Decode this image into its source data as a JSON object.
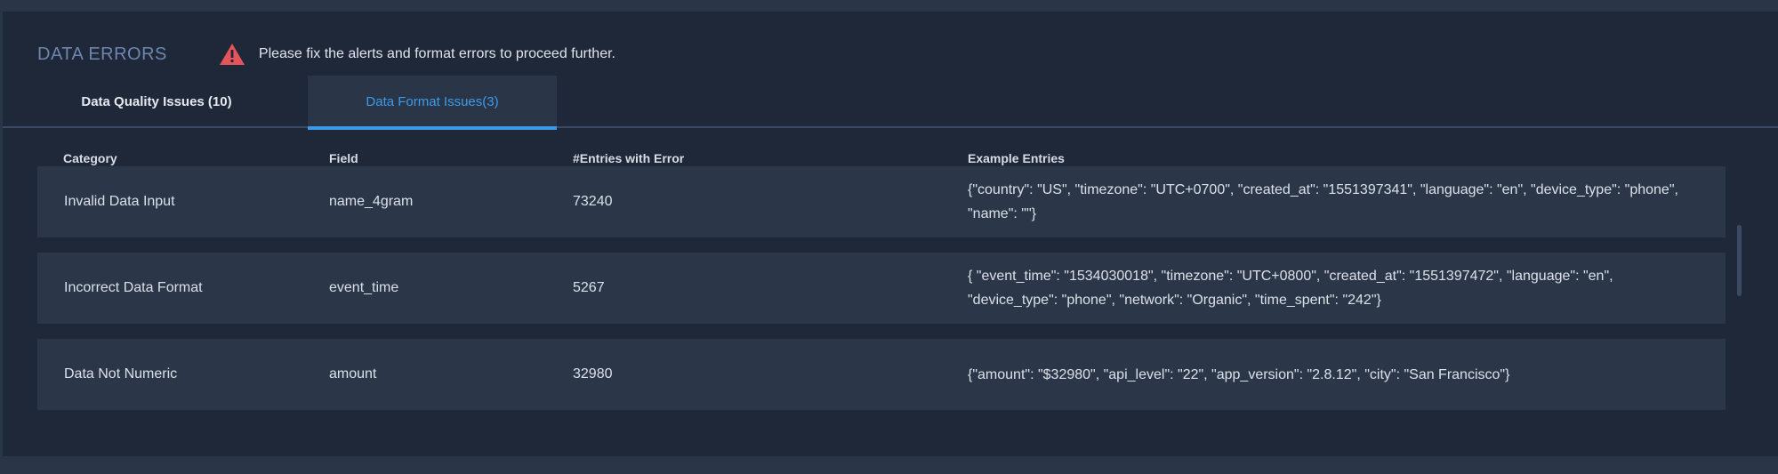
{
  "header": {
    "title": "DATA ERRORS",
    "warning_icon": "warning-triangle-icon",
    "warning_color": "#e5545a",
    "warning_text": "Please fix the alerts and format errors to proceed further."
  },
  "tabs": [
    {
      "label": "Data Quality Issues (10)",
      "active": false
    },
    {
      "label": "Data Format Issues(3)",
      "active": true
    }
  ],
  "accent_color": "#3c9be9",
  "table": {
    "columns": [
      "Category",
      "Field",
      "#Entries with Error",
      "Example Entries"
    ],
    "rows": [
      {
        "category": "Invalid Data Input",
        "field": "name_4gram",
        "entries": "73240",
        "example": "{\"country\": \"US\", \"timezone\": \"UTC+0700\", \"created_at\": \"1551397341\", \"language\": \"en\", \"device_type\": \"phone\", \"name\": \"\"}"
      },
      {
        "category": "Incorrect Data Format",
        "field": "event_time",
        "entries": "5267",
        "example": "{ \"event_time\": \"1534030018\", \"timezone\": \"UTC+0800\", \"created_at\": \"1551397472\", \"language\": \"en\", \"device_type\": \"phone\", \"network\": \"Organic\", \"time_spent\": \"242\"}"
      },
      {
        "category": "Data Not Numeric",
        "field": "amount",
        "entries": "32980",
        "example": "{\"amount\": \"$32980\", \"api_level\": \"22\", \"app_version\": \"2.8.12\", \"city\": \"San Francisco\"}"
      }
    ]
  }
}
